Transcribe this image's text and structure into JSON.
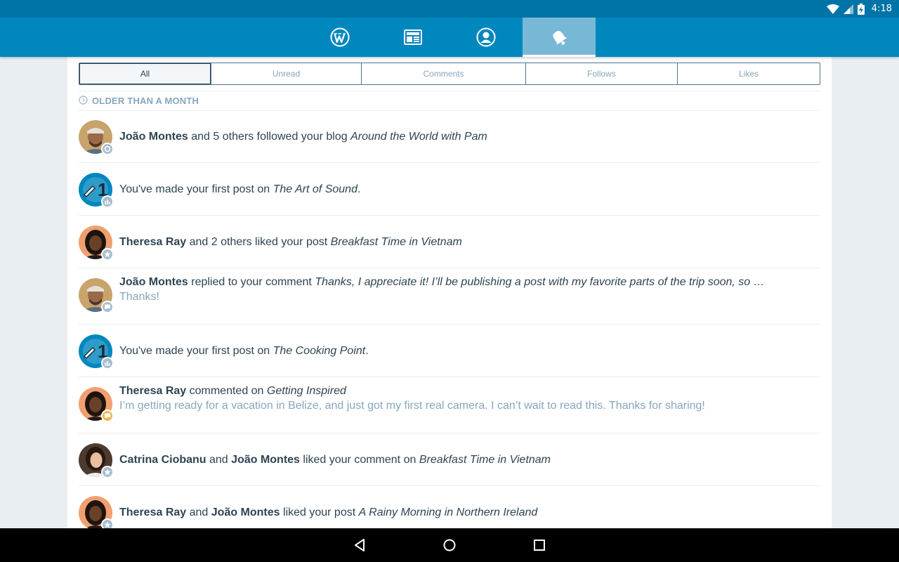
{
  "status_bar": {
    "time": "4:18",
    "icons": [
      "wifi-icon",
      "cell-signal-icon",
      "battery-charging-icon"
    ]
  },
  "nav": {
    "tabs": [
      {
        "name": "my-sites",
        "icon": "wordpress-icon"
      },
      {
        "name": "reader",
        "icon": "reader-icon"
      },
      {
        "name": "me",
        "icon": "profile-icon"
      },
      {
        "name": "notifications",
        "icon": "bell-icon",
        "active": true
      }
    ]
  },
  "filters": {
    "all": "All",
    "unread": "Unread",
    "comments": "Comments",
    "follows": "Follows",
    "likes": "Likes",
    "selected": "All"
  },
  "section": {
    "header": "OLDER THAN A MONTH",
    "icon": "clock-icon"
  },
  "notes": [
    {
      "actor": "João Montes",
      "mid": " and 5 others followed your blog ",
      "target": "Around the World with Pam",
      "badge": "follow-icon"
    },
    {
      "pre": "You've made your first post on ",
      "target": "The Art of Sound",
      "post": ".",
      "badge": "stats-icon"
    },
    {
      "actor": "Theresa Ray",
      "mid": " and 2 others liked your post ",
      "target": "Breakfast Time in Vietnam",
      "badge": "star-icon"
    },
    {
      "actor": "João Montes",
      "mid": " replied to your comment ",
      "target": "Thanks, I appreciate it! I’ll be publishing a post with my favorite parts of the trip soon, so …",
      "sub": "Thanks!",
      "badge": "comment-icon"
    },
    {
      "pre": "You've made your first post on ",
      "target": "The Cooking Point",
      "post": ".",
      "badge": "stats-icon"
    },
    {
      "actor": "Theresa Ray",
      "mid": " commented on ",
      "target": "Getting Inspired",
      "sub": "I’m getting ready for a vacation in Belize, and just got my first real camera. I can’t wait to read this. Thanks for sharing!",
      "badge": "comment-icon"
    },
    {
      "actor": "Catrina Ciobanu",
      "mid": " and ",
      "actor2": "João Montes",
      "mid2": " liked your comment on ",
      "target": "Breakfast Time in Vietnam",
      "badge": "star-icon"
    },
    {
      "actor": "Theresa Ray",
      "mid": " and ",
      "actor2": "João Montes",
      "mid2": " liked your post ",
      "target": "A Rainy Morning in Northern Ireland",
      "badge": "star-icon"
    }
  ],
  "system_nav": {
    "icons": [
      "back-icon",
      "home-icon",
      "recents-icon"
    ]
  },
  "colors": {
    "primary": "#0087be",
    "status_bar": "#0074a7",
    "text": "#2e4453",
    "muted": "#87a6bc",
    "badge": "#a8bece",
    "badge_unread_comment": "#f0b849"
  }
}
